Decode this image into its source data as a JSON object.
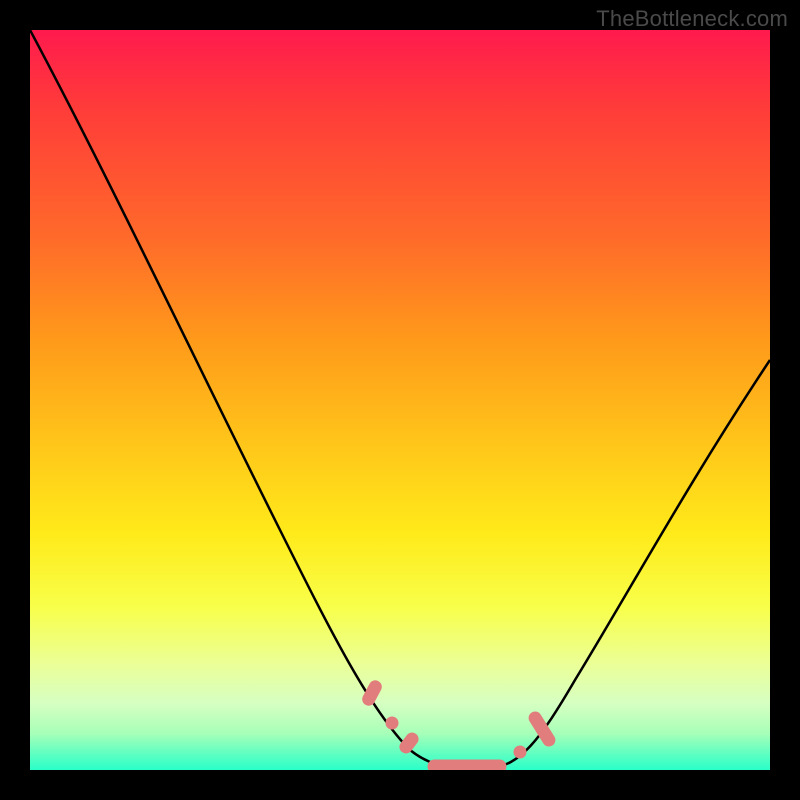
{
  "watermark": "TheBottleneck.com",
  "colors": {
    "frame": "#000000",
    "curve": "#000000",
    "marker": "#e27d7d",
    "gradient_top": "#ff1a4e",
    "gradient_bottom": "#2affc8"
  },
  "chart_data": {
    "type": "line",
    "title": "",
    "xlabel": "",
    "ylabel": "",
    "xlim": [
      0,
      100
    ],
    "ylim": [
      0,
      100
    ],
    "grid": false,
    "legend": false,
    "annotations": [
      "TheBottleneck.com"
    ],
    "series": [
      {
        "name": "bottleneck-curve",
        "x": [
          0,
          6,
          12,
          18,
          24,
          30,
          36,
          42,
          47,
          51,
          55,
          59,
          63,
          67,
          72,
          78,
          84,
          90,
          96,
          100
        ],
        "y": [
          100,
          86,
          72,
          59,
          47,
          36,
          26,
          17,
          10,
          5,
          2,
          0.5,
          0.5,
          2,
          7,
          15,
          25,
          36,
          47,
          55
        ]
      }
    ],
    "markers": [
      {
        "name": "left-upper-lozenge",
        "x": 46,
        "y": 10,
        "shape": "lozenge"
      },
      {
        "name": "left-mid-dot",
        "x": 49,
        "y": 6,
        "shape": "dot"
      },
      {
        "name": "left-lower-lozenge",
        "x": 51.5,
        "y": 3.5,
        "shape": "lozenge"
      },
      {
        "name": "trough-bar",
        "x_start": 54,
        "x_end": 64,
        "y": 0.5,
        "shape": "bar"
      },
      {
        "name": "right-dot",
        "x": 66,
        "y": 2,
        "shape": "dot"
      },
      {
        "name": "right-lozenge",
        "x": 70,
        "y": 6,
        "shape": "lozenge-long"
      }
    ]
  }
}
